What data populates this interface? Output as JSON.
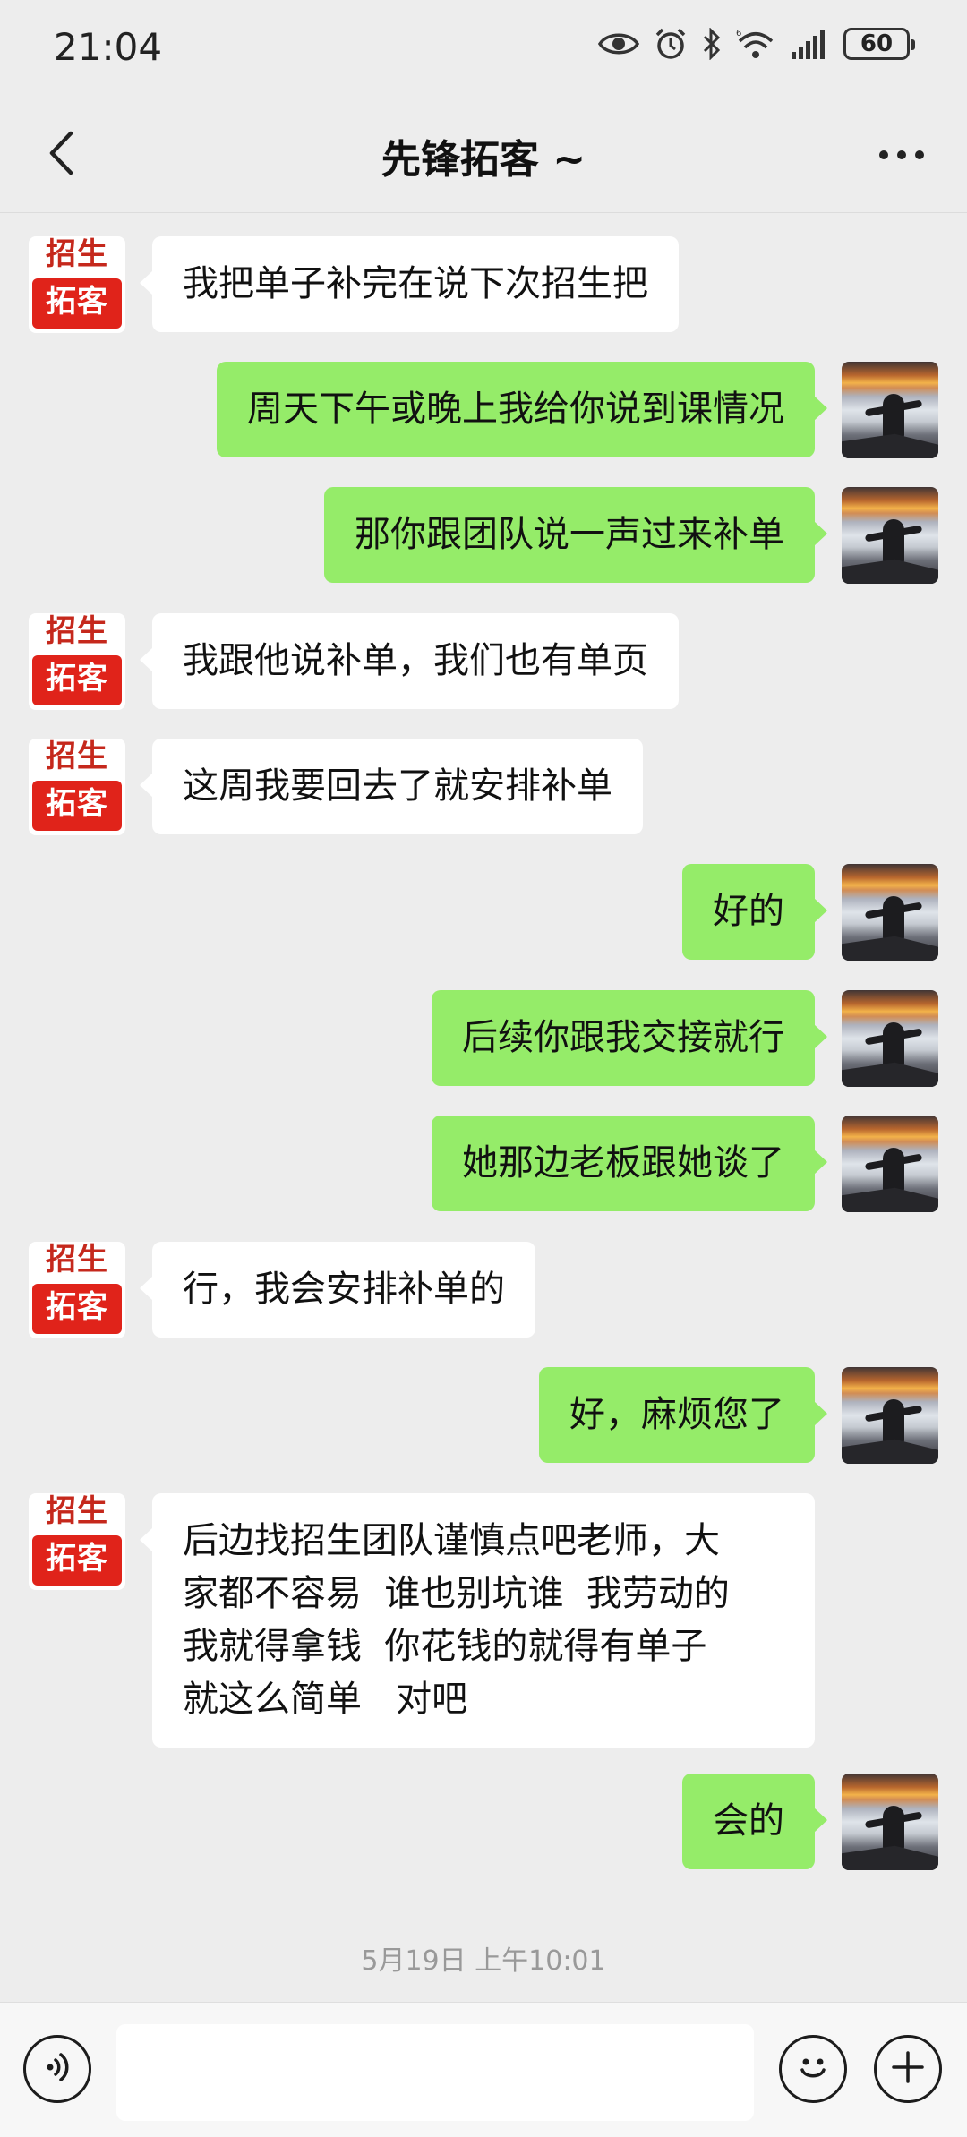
{
  "status_bar": {
    "time": "21:04",
    "battery": "60",
    "icons": [
      "eye-icon",
      "alarm-icon",
      "bluetooth-icon",
      "wifi-6-icon",
      "signal-icon",
      "battery-icon"
    ]
  },
  "nav": {
    "title": "先锋拓客 ~",
    "back_icon": "chevron-left-icon",
    "more_icon": "more-dots-icon"
  },
  "contact_avatar": {
    "line1": "招生",
    "line2": "拓客"
  },
  "messages": [
    {
      "side": "left",
      "text": "我把单子补完在说下次招生把"
    },
    {
      "side": "right",
      "text": "周天下午或晚上我给你说到课情况"
    },
    {
      "side": "right",
      "text": "那你跟团队说一声过来补单"
    },
    {
      "side": "left",
      "text": "我跟他说补单，我们也有单页"
    },
    {
      "side": "left",
      "text": "这周我要回去了就安排补单"
    },
    {
      "side": "right",
      "text": "好的"
    },
    {
      "side": "right",
      "text": "后续你跟我交接就行"
    },
    {
      "side": "right",
      "text": "她那边老板跟她谈了"
    },
    {
      "side": "left",
      "text": "行，我会安排补单的"
    },
    {
      "side": "right",
      "text": "好，麻烦您了"
    },
    {
      "side": "left",
      "text": "后边找招生团队谨慎点吧老师，大\n家都不容易  谁也别坑谁  我劳动的\n我就得拿钱  你花钱的就得有单子\n就这么简单   对吧"
    },
    {
      "side": "right",
      "text": "会的"
    }
  ],
  "timestamp": "5月19日 上午10:01",
  "input_bar": {
    "voice_icon": "voice-icon",
    "input_value": "",
    "emoji_icon": "emoji-icon",
    "plus_icon": "plus-icon"
  },
  "colors": {
    "background": "#ededed",
    "sent_bubble": "#95ec69",
    "received_bubble": "#ffffff",
    "brand_red": "#e0231a"
  }
}
